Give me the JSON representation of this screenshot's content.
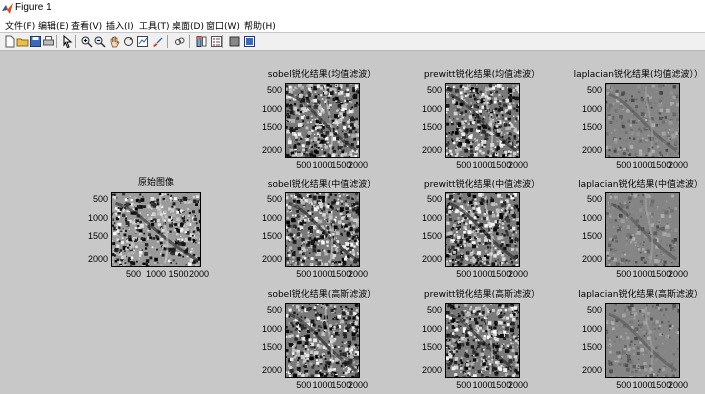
{
  "window": {
    "title": "Figure 1"
  },
  "menu": [
    "文件(F)",
    "编辑(E)",
    "查看(V)",
    "插入(I)",
    "工具(T)",
    "桌面(D)",
    "窗口(W)",
    "帮助(H)"
  ],
  "toolbar": [
    "new-file-icon",
    "open-folder-icon",
    "save-icon",
    "print-icon",
    "arrow-select-icon",
    "zoom-in-icon",
    "zoom-out-icon",
    "pan-hand-icon",
    "rotate-3d-icon",
    "data-cursor-icon",
    "brush-icon",
    "link-plot-icon",
    "colorbar-icon",
    "legend-icon",
    "hide-plot-tools-icon",
    "show-plot-tools-icon"
  ],
  "axis_ticks": {
    "y": [
      "500",
      "1000",
      "1500",
      "2000"
    ],
    "x": [
      "500",
      "1000",
      "1500",
      "2000"
    ]
  },
  "plots": [
    {
      "title": "原始图像"
    },
    {
      "title": "sobel锐化结果(均值滤波）"
    },
    {
      "title": "prewitt锐化结果(均值滤波）"
    },
    {
      "title": "laplacian锐化结果(均值滤波））"
    },
    {
      "title": "sobel锐化结果(中值滤波）"
    },
    {
      "title": "prewitt锐化结果(中值滤波）"
    },
    {
      "title": "laplacian锐化结果(中值滤波）"
    },
    {
      "title": "sobel锐化结果(高斯滤波）"
    },
    {
      "title": "prewitt锐化结果(高斯滤波）"
    },
    {
      "title": "laplacian锐化结果(高斯滤波）"
    }
  ]
}
